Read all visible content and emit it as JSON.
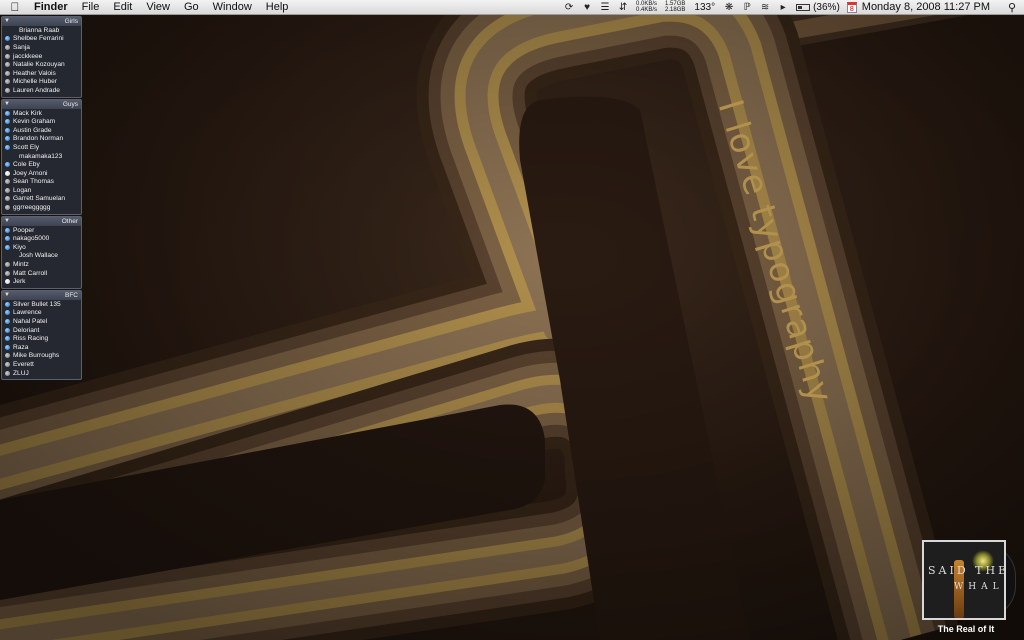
{
  "menubar": {
    "apple_icon": "apple-icon",
    "app_name": "Finder",
    "items": [
      "File",
      "Edit",
      "View",
      "Go",
      "Window",
      "Help"
    ],
    "net_up": "0.0KB/s",
    "net_down": "0.4KB/s",
    "mem_1": "1.57GB",
    "mem_2": "2.18GB",
    "temperature": "133°",
    "battery_percent": "(36%)",
    "battery_level": 0.36,
    "calendar_day": "8",
    "clock": "Monday 8, 2008  11:27 PM"
  },
  "wallpaper": {
    "text": "I love typography",
    "accent_color": "#b2914e"
  },
  "buddy_list": {
    "groups": [
      {
        "name": "Girls",
        "buddies": [
          {
            "name": "Brianna Raab",
            "status": "mobile"
          },
          {
            "name": "Shelbee Ferrarini",
            "status": "online"
          },
          {
            "name": "Sanja",
            "status": "away"
          },
          {
            "name": "jacckkeee",
            "status": "away"
          },
          {
            "name": "Natalie Kozouyan",
            "status": "away"
          },
          {
            "name": "Heather Valois",
            "status": "away"
          },
          {
            "name": "Michelle Huber",
            "status": "away"
          },
          {
            "name": "Lauren Andrade",
            "status": "away"
          }
        ]
      },
      {
        "name": "Guys",
        "buddies": [
          {
            "name": "Mack Kirk",
            "status": "online"
          },
          {
            "name": "Kevin Graham",
            "status": "online"
          },
          {
            "name": "Austin Grade",
            "status": "online"
          },
          {
            "name": "Brandon Norman",
            "status": "online"
          },
          {
            "name": "Scott Ely",
            "status": "online"
          },
          {
            "name": "makamaka123",
            "status": "mobile"
          },
          {
            "name": "Cole Eby",
            "status": "online"
          },
          {
            "name": "Joey Arnoni",
            "status": "idle"
          },
          {
            "name": "Sean Thomas",
            "status": "away"
          },
          {
            "name": "Logan",
            "status": "away"
          },
          {
            "name": "Garrett Samuelan",
            "status": "away"
          },
          {
            "name": "ggrreeggggg",
            "status": "away"
          }
        ]
      },
      {
        "name": "Other",
        "buddies": [
          {
            "name": "Pooper",
            "status": "online"
          },
          {
            "name": "nakago5000",
            "status": "online"
          },
          {
            "name": "Kiyo",
            "status": "online"
          },
          {
            "name": "Josh Wallace",
            "status": "mobile"
          },
          {
            "name": "Mintz",
            "status": "away"
          },
          {
            "name": "Matt Carroll",
            "status": "away"
          },
          {
            "name": "Jerk",
            "status": "idle"
          }
        ]
      },
      {
        "name": "BFC",
        "buddies": [
          {
            "name": "Silver Bullet 135",
            "status": "online"
          },
          {
            "name": "Lawrence",
            "status": "online"
          },
          {
            "name": "Nahal Patel",
            "status": "online"
          },
          {
            "name": "Deloriant",
            "status": "online"
          },
          {
            "name": "Riss Racing",
            "status": "online"
          },
          {
            "name": "Raza",
            "status": "online"
          },
          {
            "name": "Mike Burroughs",
            "status": "away"
          },
          {
            "name": "Everett",
            "status": "away"
          },
          {
            "name": "ZLUJ",
            "status": "away"
          }
        ]
      }
    ]
  },
  "now_playing": {
    "title": "The Real of It",
    "cover_text_1": "SAID THE",
    "cover_text_2": "WHALE"
  }
}
